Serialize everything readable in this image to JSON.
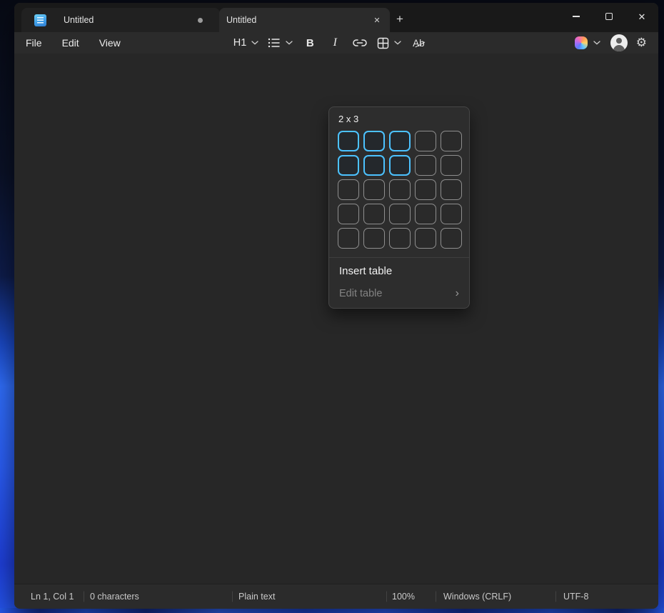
{
  "colors": {
    "accent": "#4CC2FF",
    "selected_cell_border": "#4CC2FF",
    "cell_border": "#8E8E8E"
  },
  "titlebar": {
    "tabs": [
      {
        "label": "Untitled",
        "active": false,
        "unsaved": true
      },
      {
        "label": "Untitled",
        "active": true,
        "unsaved": false
      }
    ],
    "tab_close_glyph": "✕",
    "new_tab_glyph": "+",
    "close_glyph": "✕"
  },
  "menubar": {
    "items": [
      "File",
      "Edit",
      "View"
    ]
  },
  "toolbar": {
    "heading_label": "H1",
    "bold_glyph": "B",
    "italic_glyph": "I",
    "clear_format_glyph": "Ab"
  },
  "table_flyout": {
    "size_label": "2 x 3",
    "grid": {
      "rows": 5,
      "cols": 5,
      "selected_rows": 2,
      "selected_cols": 3
    },
    "insert_label": "Insert table",
    "edit_label": "Edit table",
    "edit_chevron_glyph": "›"
  },
  "statusbar": {
    "cursor_position": "Ln 1, Col 1",
    "character_count": "0 characters",
    "document_type": "Plain text",
    "zoom_level": "100%",
    "line_ending": "Windows (CRLF)",
    "encoding": "UTF-8"
  },
  "icons": {
    "settings_gear_glyph": "⚙"
  }
}
